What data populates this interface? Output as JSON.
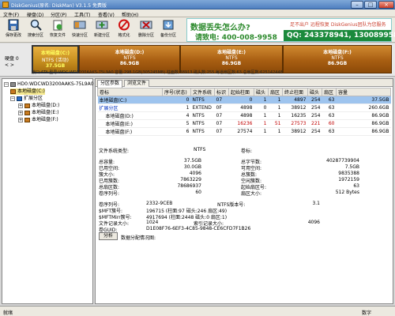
{
  "window": {
    "title": "DiskGenius(原名: DiskMan) V3.1.5 免费版",
    "minimize": "–",
    "maximize": "□",
    "close": "×"
  },
  "menu": [
    "文件(F)",
    "硬盘(D)",
    "分区(P)",
    "工具(T)",
    "查看(V)",
    "帮助(H)"
  ],
  "toolbar": [
    {
      "label": "保存更改",
      "icon": "save-icon"
    },
    {
      "label": "搜索分区",
      "icon": "search-partition-icon"
    },
    {
      "label": "恢复文件",
      "icon": "recover-file-icon"
    },
    {
      "label": "快速分区",
      "icon": "quick-partition-icon"
    },
    {
      "label": "新建分区",
      "icon": "new-partition-icon"
    },
    {
      "label": "格式化",
      "icon": "format-icon"
    },
    {
      "label": "删除分区",
      "icon": "delete-partition-icon"
    },
    {
      "label": "备份分区",
      "icon": "backup-partition-icon"
    }
  ],
  "banner": {
    "line1": "数据丢失怎么办?",
    "line2": "请致电: 400-008-9958",
    "line3": "足不出户 远程恢复 DiskGenius团队为您服务",
    "qq": "QQ: 243378941, 130089958"
  },
  "diskstrip": {
    "label": "硬盘 0",
    "nav": "< >",
    "info": "接口:ATA 型号:WDC WD3200AAKS-75L9A0 容量:298.1GB(305245MB) 柱面数:38913 磁头数:255 每道扇区数:63 总扇区数:625142448",
    "partitions": [
      {
        "name": "本地磁盘(C:)",
        "fs": "NTFS (活动)",
        "size": "37.5GB"
      },
      {
        "name": "本地磁盘(D:)",
        "fs": "NTFS",
        "size": "86.9GB"
      },
      {
        "name": "本地磁盘(E:)",
        "fs": "NTFS",
        "size": "86.9GB"
      },
      {
        "name": "本地磁盘(F:)",
        "fs": "NTFS",
        "size": "86.9GB"
      }
    ]
  },
  "tree": {
    "disk": "HD0:WDCWD3200AAKS-75L9A0",
    "c": "本地磁盘(C:)",
    "ext": "扩展分区",
    "d": "本地磁盘(D:)",
    "e": "本地磁盘(E:)",
    "f": "本地磁盘(F:)"
  },
  "tabs": [
    "分区参数",
    "浏览文件"
  ],
  "table": {
    "headers": [
      "卷标",
      "序号(状态)",
      "文件系统",
      "标识",
      "起始柱面",
      "磁头",
      "扇区",
      "终止柱面",
      "磁头",
      "扇区",
      "容量"
    ],
    "rows": [
      [
        "本地磁盘(C:)",
        "0",
        "NTFS",
        "07",
        "0",
        "1",
        "1",
        "4897",
        "254",
        "63",
        "37.5GB"
      ],
      [
        "扩展分区",
        "1",
        "EXTEND",
        "0F",
        "4898",
        "0",
        "1",
        "38912",
        "254",
        "63",
        "260.6GB"
      ],
      [
        "本地磁盘(D:)",
        "4",
        "NTFS",
        "07",
        "4898",
        "1",
        "1",
        "16235",
        "254",
        "63",
        "86.9GB"
      ],
      [
        "本地磁盘(E:)",
        "5",
        "NTFS",
        "07",
        "16236",
        "1",
        "51",
        "27573",
        "221",
        "60",
        "86.9GB"
      ],
      [
        "本地磁盘(F:)",
        "6",
        "NTFS",
        "07",
        "27574",
        "1",
        "1",
        "38912",
        "254",
        "63",
        "86.9GB"
      ]
    ]
  },
  "info": {
    "fs_type_label": "文件系统类型:",
    "fs_type": "NTFS",
    "volume_label": "卷标:",
    "left": [
      {
        "k": "总容量:",
        "v": "37.5GB"
      },
      {
        "k": "已用空间:",
        "v": "30.0GB"
      },
      {
        "k": "簇大小:",
        "v": "4096"
      },
      {
        "k": "已用簇数:",
        "v": "7863229"
      },
      {
        "k": "总扇区数:",
        "v": "78686937"
      },
      {
        "k": "卷序列号:",
        "v": "60"
      }
    ],
    "right": [
      {
        "k": "总字节数:",
        "v": "40287739904"
      },
      {
        "k": "可用空间:",
        "v": "7.5GB"
      },
      {
        "k": "总簇数:",
        "v": "9835388"
      },
      {
        "k": "空闲簇数:",
        "v": "1972159"
      },
      {
        "k": "起始扇区号:",
        "v": "63"
      },
      {
        "k": "扇区大小:",
        "v": "512 Bytes"
      }
    ],
    "ntfs": [
      {
        "k": "卷序列号:",
        "v": "2332-9CEB",
        "k2": "NTFS版本号:",
        "v2": "3.1"
      },
      {
        "k": "$MFT簇号:",
        "v": "196715 (柱面:97 磁头:246 扇区:49)"
      },
      {
        "k": "$MFTMirr簇号:",
        "v": "4917694 (柱面:2448 磁头:0 扇区:1)"
      },
      {
        "k": "文件记录大小:",
        "v": "1024",
        "k2": "索引记录大小:",
        "v2": "4096"
      },
      {
        "k": "卷GUID:",
        "v": "D1E08F76-6EF3-4C85-9848-CE6CFD7F1B26"
      }
    ]
  },
  "analyze": {
    "button": "分析",
    "note": "数据分配情况图:"
  },
  "status": {
    "left": "就绪",
    "right": "数字"
  }
}
